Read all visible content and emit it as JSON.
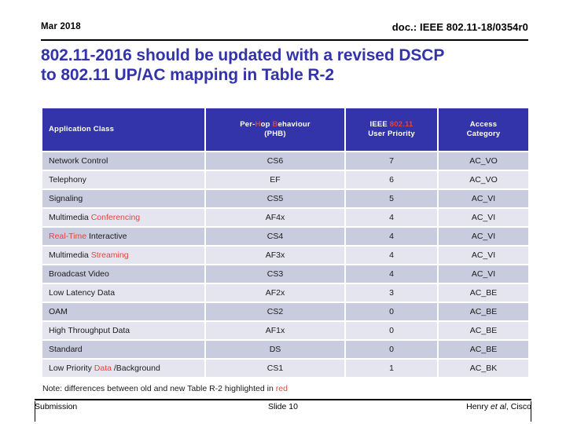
{
  "header": {
    "date": "Mar 2018",
    "doc_ref": "doc.: IEEE 802.11-18/0354r0"
  },
  "title": {
    "line1": "802.11-2016 should be updated with a revised DSCP",
    "line2": "to 802.11 UP/AC mapping in Table R-2"
  },
  "colors": {
    "header_blue": "#3333AA",
    "row_odd": "#C9CBDF",
    "row_even": "#E5E5EF",
    "highlight_red": "#E8413A"
  },
  "table": {
    "columns": [
      {
        "key": "application_class",
        "label": "Application Class",
        "align": "left"
      },
      {
        "key": "phb",
        "label_line1_a": "Per-",
        "label_line1_b": "H",
        "label_line1_c": "op ",
        "label_line1_d": "B",
        "label_line1_e": "ehaviour",
        "label_line2": "(PHB)",
        "align": "center"
      },
      {
        "key": "user_priority",
        "label_line1_a": "IEEE ",
        "label_line1_b": "802.11",
        "label_line2": "User Priority",
        "align": "center"
      },
      {
        "key": "access_category",
        "label_line1": "Access",
        "label_line2": "Category",
        "align": "center"
      }
    ],
    "rows": [
      {
        "app_plain_pre": "Network Control",
        "app_red": "",
        "app_plain_post": "",
        "phb": "CS6",
        "phb_red": false,
        "up": "7",
        "up_red": false,
        "ac": "AC_VO",
        "ac_red": false
      },
      {
        "app_plain_pre": "Telephony",
        "app_red": "",
        "app_plain_post": "",
        "phb": "EF",
        "phb_red": false,
        "up": "6",
        "up_red": false,
        "ac": "AC_VO",
        "ac_red": false
      },
      {
        "app_plain_pre": "Signaling",
        "app_red": "",
        "app_plain_post": "",
        "phb": "CS5",
        "phb_red": false,
        "up": "5",
        "up_red": false,
        "ac": "AC_VI",
        "ac_red": false
      },
      {
        "app_plain_pre": "Multimedia ",
        "app_red": "Conferencing",
        "app_plain_post": "",
        "phb": "AF4x",
        "phb_red": false,
        "up": "4",
        "up_red": true,
        "ac": "AC_VI",
        "ac_red": false
      },
      {
        "app_plain_pre": "",
        "app_red": "Real-Time",
        "app_plain_post": " Interactive",
        "phb": "CS4",
        "phb_red": false,
        "up": "4",
        "up_red": true,
        "ac": "AC_VI",
        "ac_red": true
      },
      {
        "app_plain_pre": "Multimedia ",
        "app_red": "Streaming",
        "app_plain_post": "",
        "phb": "AF3x",
        "phb_red": false,
        "up": "4",
        "up_red": false,
        "ac": "AC_VI",
        "ac_red": false
      },
      {
        "app_plain_pre": "Broadcast Video",
        "app_red": "",
        "app_plain_post": "",
        "phb": "CS3",
        "phb_red": false,
        "up": "4",
        "up_red": false,
        "ac": "AC_VI",
        "ac_red": false
      },
      {
        "app_plain_pre": "Low Latency Data",
        "app_red": "",
        "app_plain_post": "",
        "phb": "AF2x",
        "phb_red": false,
        "up": "3",
        "up_red": false,
        "ac": "AC_BE",
        "ac_red": false
      },
      {
        "app_plain_pre": "OAM",
        "app_red": "",
        "app_plain_post": "",
        "phb": "CS2",
        "phb_red": false,
        "up": "0",
        "up_red": true,
        "ac": "AC_BE",
        "ac_red": false
      },
      {
        "app_plain_pre": "High Throughput Data",
        "app_red": "",
        "app_plain_post": "",
        "phb": "AF1x",
        "phb_red": false,
        "up": "0",
        "up_red": true,
        "ac": "AC_BE",
        "ac_red": true
      },
      {
        "app_plain_pre": "Standard",
        "app_red": "",
        "app_plain_post": "",
        "phb": "DS",
        "phb_red": false,
        "up": "0",
        "up_red": false,
        "ac": "AC_BE",
        "ac_red": false
      },
      {
        "app_plain_pre": "Low Priority ",
        "app_red": "Data",
        "app_plain_post": " /Background",
        "phb": "CS1",
        "phb_red": false,
        "up": "1",
        "up_red": false,
        "ac": "AC_BK",
        "ac_red": false
      }
    ]
  },
  "note": {
    "text": "Note: differences  between old and new Table R-2 highlighted in ",
    "red_word": "red"
  },
  "footer": {
    "left": "Submission",
    "center": "Slide 10",
    "right_pre": "Henry ",
    "right_italic": "et al",
    "right_post": ", Cisco"
  }
}
